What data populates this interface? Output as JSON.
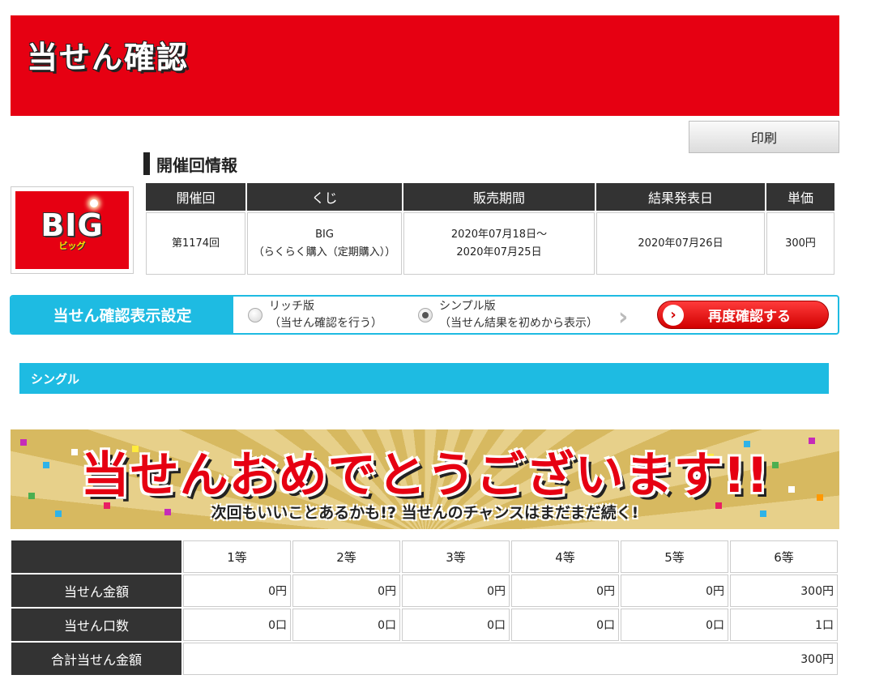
{
  "header": {
    "title": "当せん確認"
  },
  "toolbar": {
    "print_label": "印刷"
  },
  "draw_info": {
    "section_title": "開催回情報",
    "logo": {
      "text": "BIG",
      "sub": "ビッグ"
    },
    "columns": [
      "開催回",
      "くじ",
      "販売期間",
      "結果発表日",
      "単価"
    ],
    "row": {
      "round": "第1174回",
      "lottery_line1": "BIG",
      "lottery_line2": "（らくらく購入（定期購入））",
      "sales_start": "2020年07月18日～",
      "sales_end": "2020年07月25日",
      "result_date": "2020年07月26日",
      "price": "300円"
    }
  },
  "display_settings": {
    "label": "当せん確認表示設定",
    "options": [
      {
        "title": "リッチ版",
        "desc": "（当せん確認を行う）",
        "selected": false
      },
      {
        "title": "シンプル版",
        "desc": "（当せん結果を初めから表示）",
        "selected": true
      }
    ],
    "recheck_label": "再度確認する"
  },
  "single_section": {
    "label": "シングル"
  },
  "banner": {
    "main": "当せんおめでとうございます!!",
    "sub": "次回もいいことあるかも!? 当せんのチャンスはまだまだ続く!"
  },
  "results": {
    "prize_ranks": [
      "1等",
      "2等",
      "3等",
      "4等",
      "5等",
      "6等"
    ],
    "rows": [
      {
        "label": "当せん金額",
        "values": [
          "0円",
          "0円",
          "0円",
          "0円",
          "0円",
          "300円"
        ]
      },
      {
        "label": "当せん口数",
        "values": [
          "0口",
          "0口",
          "0口",
          "0口",
          "0口",
          "1口"
        ]
      }
    ],
    "total": {
      "label": "合計当せん金額",
      "value": "300円"
    }
  },
  "colors": {
    "brand_red": "#e60012",
    "accent_blue": "#1ebbe2",
    "dark_header": "#333333"
  }
}
